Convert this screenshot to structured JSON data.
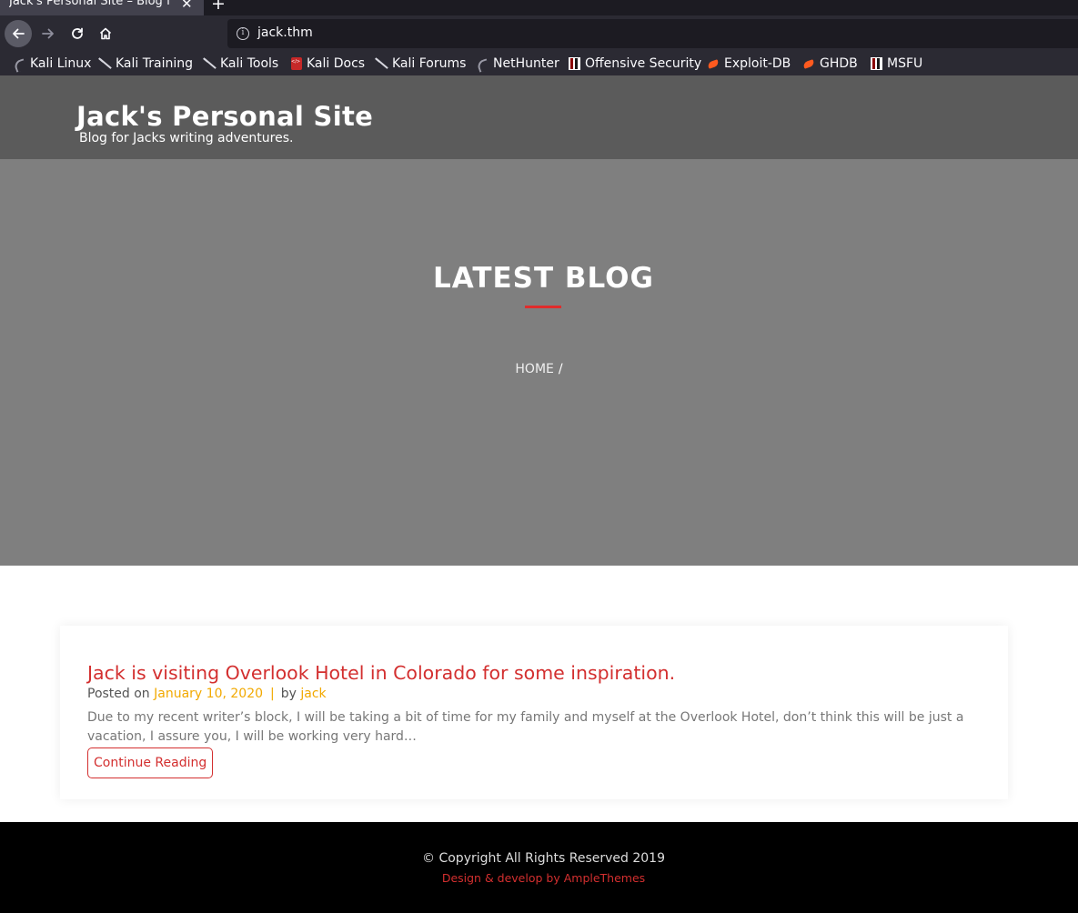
{
  "browser": {
    "tab_title": "Jack's Personal Site – Blog f",
    "tab_close": "✕",
    "new_tab": "+",
    "url": "jack.thm",
    "bookmarks": [
      {
        "label": "Kali Linux",
        "icon": "kali-dragon-icon"
      },
      {
        "label": "Kali Training",
        "icon": "kali-slash-icon"
      },
      {
        "label": "Kali Tools",
        "icon": "kali-slash-icon"
      },
      {
        "label": "Kali Docs",
        "icon": "kali-docs-icon"
      },
      {
        "label": "Kali Forums",
        "icon": "kali-slash-icon"
      },
      {
        "label": "NetHunter",
        "icon": "kali-dragon-icon"
      },
      {
        "label": "Offensive Security",
        "icon": "offsec-icon"
      },
      {
        "label": "Exploit-DB",
        "icon": "exploit-db-icon"
      },
      {
        "label": "GHDB",
        "icon": "exploit-db-icon"
      },
      {
        "label": "MSFU",
        "icon": "offsec-icon"
      }
    ]
  },
  "site": {
    "title": "Jack's Personal Site",
    "tagline": "Blog for Jacks writing adventures."
  },
  "hero": {
    "title": "LATEST BLOG",
    "breadcrumb_home": "HOME",
    "breadcrumb_sep": "/"
  },
  "post": {
    "title": "Jack is visiting Overlook Hotel in Colorado for some inspiration.",
    "posted_on_label": "Posted on",
    "date": "January 10, 2020",
    "separator": "|",
    "by_label": "by",
    "author": "jack",
    "excerpt": "Due to my recent writer’s block, I will be taking a bit of time for my family and myself at the Overlook Hotel, don’t think this will be just a vacation, I assure you, I will be working very hard…",
    "continue_label": "Continue Reading"
  },
  "footer": {
    "copyright": "© Copyright All Rights Reserved 2019",
    "credit": "Design & develop by AmpleThemes"
  },
  "colors": {
    "accent": "#d32f2f",
    "link_meta": "#f2a900",
    "header_bg": "#5b5b5b",
    "hero_bg": "#7f7f7f",
    "footer_bg": "#000000"
  }
}
